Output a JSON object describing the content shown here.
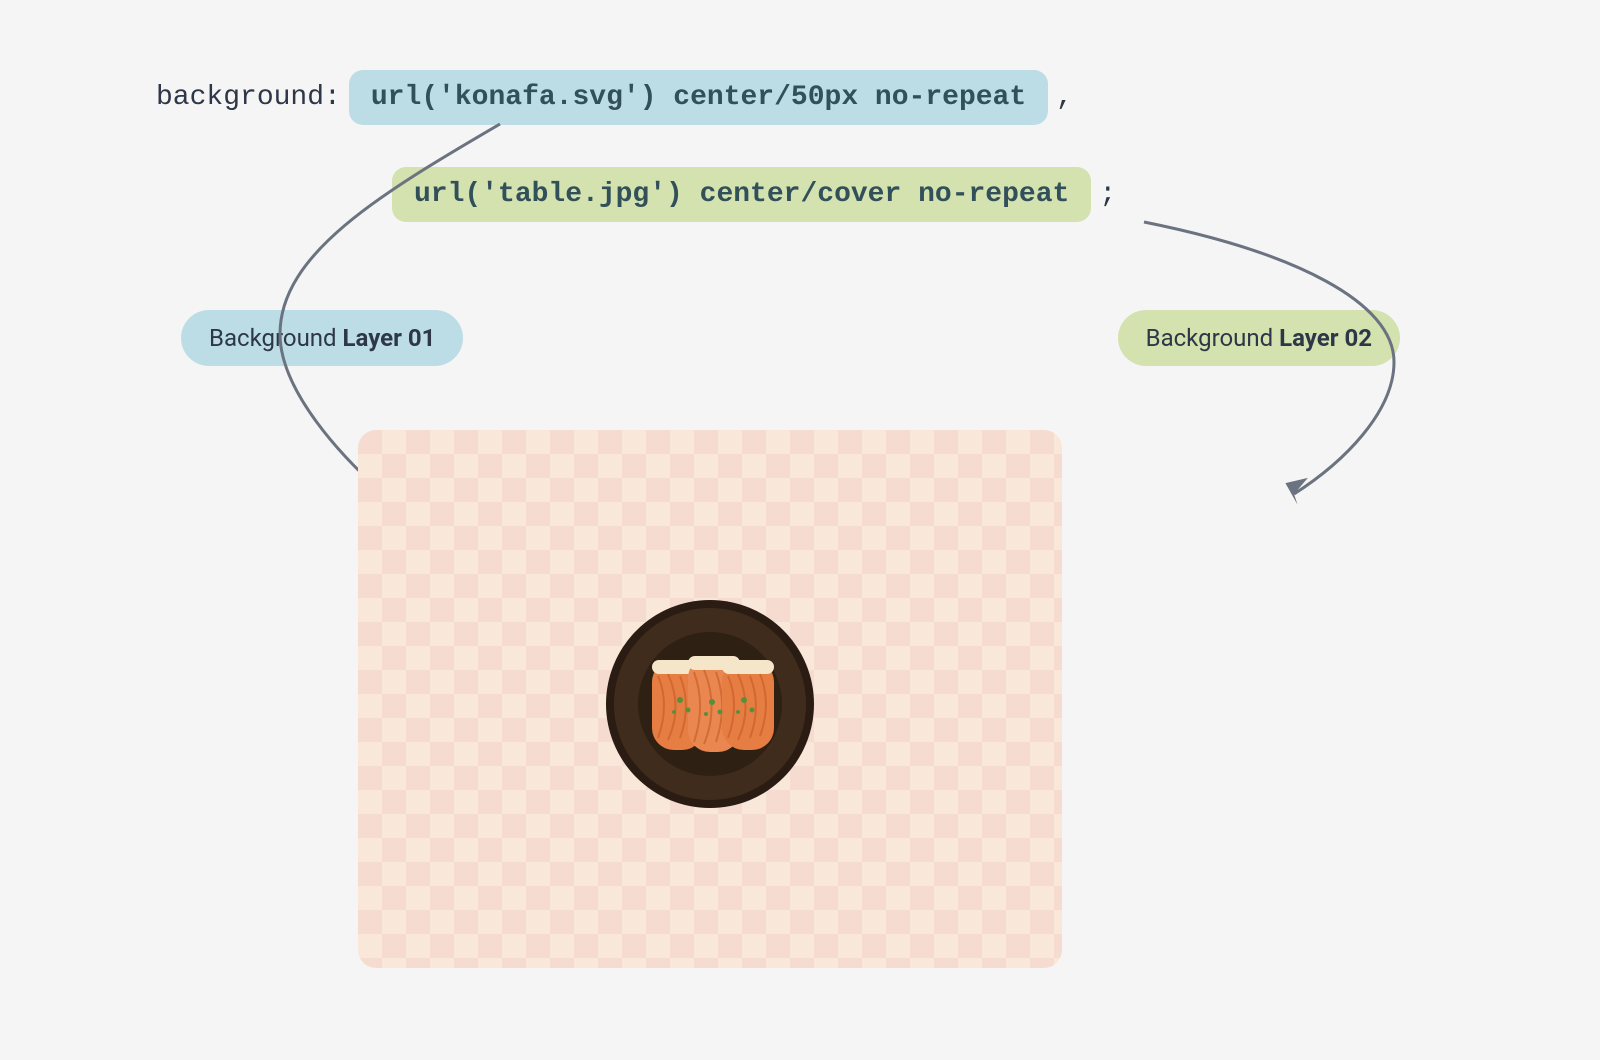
{
  "code": {
    "property": "background:",
    "layer1_css": "url('konafa.svg') center/50px no-repeat",
    "separator": ",",
    "layer2_css": "url('table.jpg') center/cover no-repeat",
    "terminator": ";"
  },
  "labels": {
    "layer1_prefix": "Background ",
    "layer1_bold": "Layer 01",
    "layer2_prefix": "Background ",
    "layer2_bold": "Layer 02"
  },
  "colors": {
    "blue": "#bcdde5",
    "green": "#d3e2ae",
    "arrow": "#6b7280",
    "tablecloth_a": "#f5d0c6",
    "tablecloth_b": "#faf3e3",
    "plate": "#3a2a1e",
    "konafa": "#e67e43"
  }
}
